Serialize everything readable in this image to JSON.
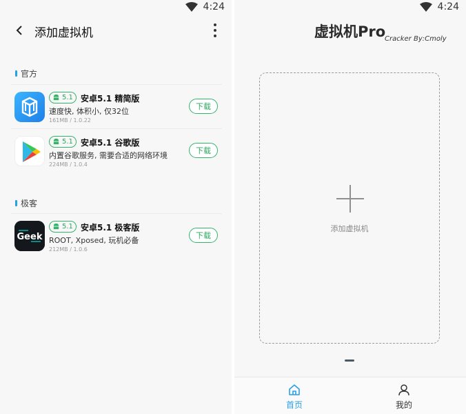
{
  "status_bar": {
    "time": "4:24"
  },
  "left": {
    "title": "添加虚拟机",
    "sections": [
      {
        "header": "官方",
        "apps": [
          {
            "version": "5.1",
            "name": "安卓5.1 精简版",
            "desc": "速度快, 体积小, 仅32位",
            "meta": "161MB / 1.0.22",
            "download": "下载",
            "icon": "vmos-cube-icon"
          },
          {
            "version": "5.1",
            "name": "安卓5.1 谷歌版",
            "desc": "内置谷歌服务, 需要合适的网络环境",
            "meta": "224MB / 1.0.4",
            "download": "下载",
            "icon": "google-play-icon"
          }
        ]
      },
      {
        "header": "极客",
        "apps": [
          {
            "version": "5.1",
            "name": "安卓5.1 极客版",
            "desc": "ROOT, Xposed, 玩机必备",
            "meta": "212MB / 1.0.6",
            "download": "下载",
            "icon": "geek-icon"
          }
        ]
      }
    ]
  },
  "right": {
    "title": "虚拟机Pro",
    "subtitle": "Cracker By:Cmoly",
    "add_vm_label": "添加虚拟机",
    "nav": {
      "home": "首页",
      "me": "我的"
    }
  },
  "colors": {
    "accent_blue": "#29a0e6",
    "accent_green": "#34b36a"
  }
}
